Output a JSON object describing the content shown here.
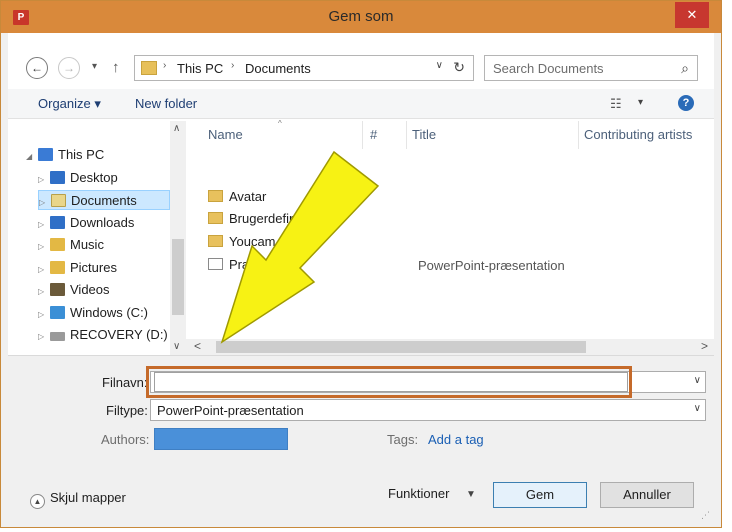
{
  "window": {
    "title": "Gem som",
    "app_icon": "P",
    "close_glyph": "✕"
  },
  "nav": {
    "back_glyph": "←",
    "forward_glyph": "→",
    "recent_glyph": "▾",
    "up_glyph": "↑",
    "address": [
      "This PC",
      "Documents"
    ],
    "address_sep": "›",
    "address_dd": "∨",
    "refresh_glyph": "↻",
    "search_placeholder": "Search Documents",
    "search_glyph": "⌕"
  },
  "toolbar": {
    "organize": "Organize ▾",
    "new_folder": "New folder",
    "view_glyph": "☷",
    "view_dd": "▾",
    "help_glyph": "?"
  },
  "tree": {
    "items": [
      {
        "label": "This PC",
        "icon": "computer-icon"
      },
      {
        "label": "Desktop",
        "icon": "desktop-icon"
      },
      {
        "label": "Documents",
        "icon": "documents-icon",
        "selected": true
      },
      {
        "label": "Downloads",
        "icon": "downloads-icon"
      },
      {
        "label": "Music",
        "icon": "music-icon"
      },
      {
        "label": "Pictures",
        "icon": "pictures-icon"
      },
      {
        "label": "Videos",
        "icon": "videos-icon"
      },
      {
        "label": "Windows (C:)",
        "icon": "drive-icon"
      },
      {
        "label": "RECOVERY (D:)",
        "icon": "drive-icon"
      }
    ],
    "expanded_arrow": "◢",
    "collapsed_arrow": "▷",
    "scroll_up": "∧",
    "scroll_down": "∨"
  },
  "files": {
    "columns": [
      "Name",
      "#",
      "Title",
      "Contributing artists"
    ],
    "sort_glyph": "^",
    "rows": [
      {
        "name": "Avatar",
        "type": "folder",
        "title": ""
      },
      {
        "name": "Brugerdefiner",
        "type": "folder",
        "title": ""
      },
      {
        "name": "Youcam",
        "type": "folder",
        "title": ""
      },
      {
        "name": "Præsent",
        "type": "file",
        "title": "PowerPoint-præsentation"
      }
    ],
    "hscroll_left": "<",
    "hscroll_right": ">"
  },
  "form": {
    "filename_label": "Filnavn:",
    "filename_value": "",
    "filetype_label": "Filtype:",
    "filetype_value": "PowerPoint-præsentation",
    "authors_label": "Authors:",
    "tags_label": "Tags:",
    "tags_link": "Add a tag",
    "combo_dd": "∨"
  },
  "footer": {
    "hide_folders": "Skjul mapper",
    "hide_glyph": "▲",
    "tools": "Funktioner",
    "tools_dd": "▼",
    "save": "Gem",
    "cancel": "Annuller",
    "grip": "⋰"
  },
  "colors": {
    "titlebar": "#d9893b",
    "close": "#c7372f",
    "annotation_arrow": "#f7f214",
    "highlight_box": "#c56a2a",
    "authors_fill": "#4a90d9"
  }
}
